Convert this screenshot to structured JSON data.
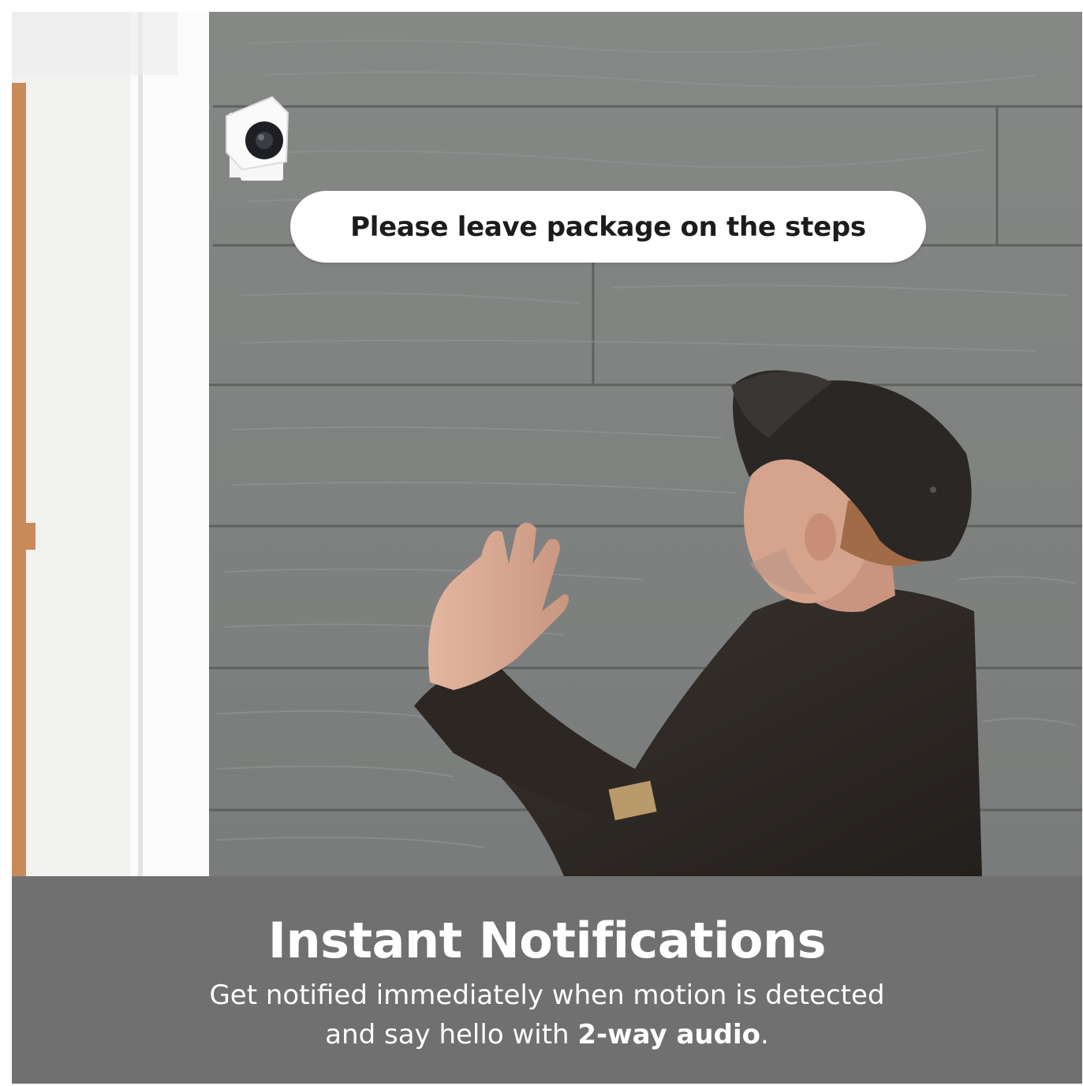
{
  "speech_bubble": {
    "text": "Please leave package on the steps"
  },
  "caption": {
    "title": "Instant Notifications",
    "line1": "Get notified immediately when motion is detected",
    "line2_prefix": "and say hello with ",
    "line2_bold": "2-way audio",
    "line2_suffix": "."
  },
  "colors": {
    "caption_bg": "#707070",
    "siding": "#7d7f7e",
    "door_trim": "#ffffff",
    "camera": "#ffffff",
    "uniform": "#2f2a26"
  },
  "icons": [
    "security-camera-icon"
  ]
}
